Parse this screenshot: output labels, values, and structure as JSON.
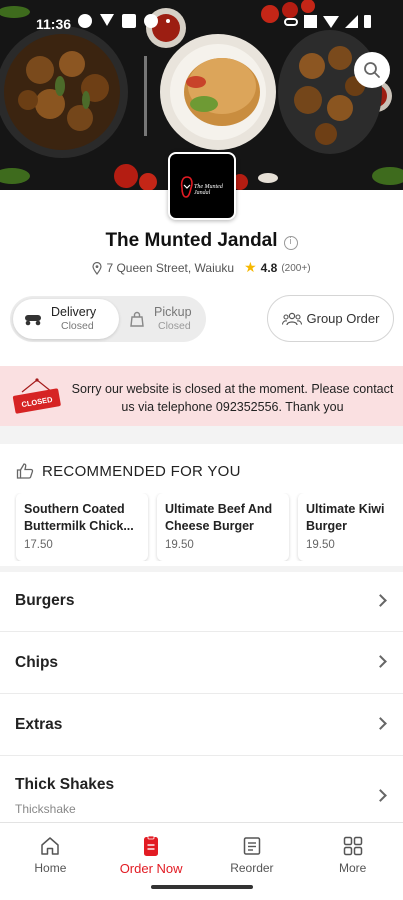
{
  "status_bar": {
    "time": "11:36"
  },
  "restaurant": {
    "name": "The Munted Jandal",
    "address": "7 Queen Street, Waiuku",
    "rating": "4.8",
    "rating_count": "(200+)",
    "logo_text": "The Munted Jandal"
  },
  "order_mode": {
    "delivery": {
      "label": "Delivery",
      "status": "Closed"
    },
    "pickup": {
      "label": "Pickup",
      "status": "Closed"
    },
    "selected": "delivery",
    "group_order_label": "Group Order"
  },
  "closed_banner": {
    "sign_text": "CLOSED",
    "message": "Sorry our website is closed at the moment. Please contact us via telephone 092352556. Thank you"
  },
  "recommended": {
    "title": "RECOMMENDED FOR YOU",
    "items": [
      {
        "name": "Southern Coated Buttermilk Chick...",
        "price": "17.50"
      },
      {
        "name": "Ultimate Beef And Cheese Burger",
        "price": "19.50"
      },
      {
        "name": "Ultimate Kiwi Burger",
        "price": "19.50"
      }
    ]
  },
  "categories": [
    {
      "label": "Burgers",
      "sub": ""
    },
    {
      "label": "Chips",
      "sub": ""
    },
    {
      "label": "Extras",
      "sub": ""
    },
    {
      "label": "Thick Shakes",
      "sub": "Thickshake"
    }
  ],
  "bottom_nav": [
    {
      "label": "Home",
      "icon": "home-icon",
      "active": false
    },
    {
      "label": "Order Now",
      "icon": "order-icon",
      "active": true
    },
    {
      "label": "Reorder",
      "icon": "reorder-icon",
      "active": false
    },
    {
      "label": "More",
      "icon": "grid-icon",
      "active": false
    }
  ],
  "colors": {
    "accent": "#e21b23",
    "banner_bg": "#fae0e1",
    "star": "#f6b800"
  }
}
